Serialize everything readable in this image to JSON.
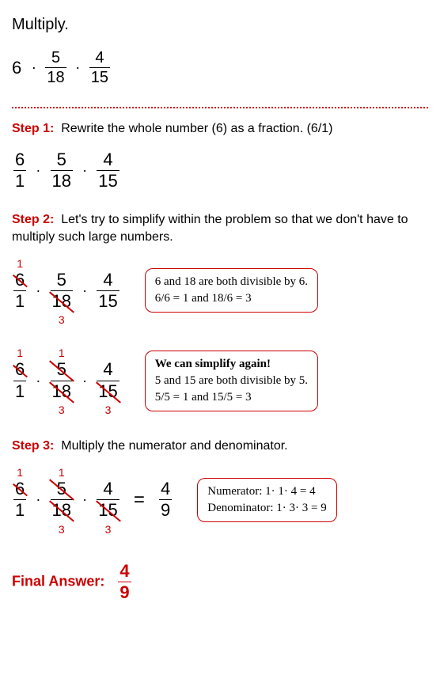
{
  "title": "Multiply.",
  "initial": {
    "whole": "6",
    "f1_num": "5",
    "f1_den": "18",
    "f2_num": "4",
    "f2_den": "15"
  },
  "step1": {
    "label": "Step 1:",
    "text": "Rewrite the whole number (6) as a fraction.  (6/1)",
    "f1_num": "6",
    "f1_den": "1",
    "f2_num": "5",
    "f2_den": "18",
    "f3_num": "4",
    "f3_den": "15"
  },
  "step2": {
    "label": "Step 2:",
    "text": "Let's try to simplify within the problem so that we don't have to multiply such large numbers.",
    "partA": {
      "f1_num": "6",
      "f1_den": "1",
      "f2_num": "5",
      "f2_den": "18",
      "f3_num": "4",
      "f3_den": "15",
      "ann1_top": "1",
      "ann2_bot": "3",
      "box_l1": "6 and 18 are both divisible by 6.",
      "box_l2": "6/6 = 1    and    18/6 = 3"
    },
    "partB": {
      "f1_num": "6",
      "f1_den": "1",
      "f2_num": "5",
      "f2_den": "18",
      "f3_num": "4",
      "f3_den": "15",
      "ann1_top": "1",
      "ann2_top": "1",
      "ann2_bot": "3",
      "ann3_bot": "3",
      "box_bold": "We can simplify again!",
      "box_l1": "5 and 15 are both divisible by 5.",
      "box_l2": "5/5 = 1    and     15/5 = 3"
    }
  },
  "step3": {
    "label": "Step 3:",
    "text": "Multiply the numerator and denominator.",
    "f1_num": "6",
    "f1_den": "1",
    "f2_num": "5",
    "f2_den": "18",
    "f3_num": "4",
    "f3_den": "15",
    "ann1_top": "1",
    "ann2_top": "1",
    "ann2_bot": "3",
    "ann3_bot": "3",
    "result_num": "4",
    "result_den": "9",
    "box_l1": "Numerator:  1· 1· 4 = 4",
    "box_l2": "Denominator:  1· 3· 3 = 9"
  },
  "final": {
    "label": "Final Answer:",
    "num": "4",
    "den": "9"
  }
}
